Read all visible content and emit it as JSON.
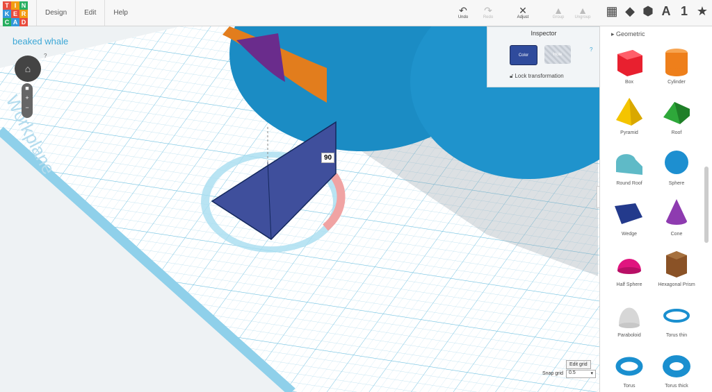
{
  "app": {
    "logo_letters": [
      "T",
      "I",
      "N",
      "K",
      "E",
      "R",
      "C",
      "A",
      "D"
    ],
    "logo_colors": [
      "#e84c3d",
      "#f39c12",
      "#27ae60",
      "#3498db",
      "#e84c3d",
      "#f39c12",
      "#27ae60",
      "#3498db",
      "#e84c3d"
    ]
  },
  "menu": [
    "Design",
    "Edit",
    "Help"
  ],
  "toolbar": {
    "undo": "Undo",
    "redo": "Redo",
    "adjust": "Adjust",
    "group": "Group",
    "ungroup": "Ungroup"
  },
  "project": {
    "title": "beaked whale",
    "help": "?"
  },
  "workplane_label": "Workplane",
  "rotation_value": "90",
  "inspector": {
    "title": "Inspector",
    "color_label": "Color",
    "hole_label": "Hole",
    "help": "?",
    "lock_label": "Lock transformation",
    "color_value": "#2f4b9c"
  },
  "sidebar": {
    "category": "Geometric",
    "shapes": [
      {
        "name": "Box",
        "color": "#e8202f"
      },
      {
        "name": "Cylinder",
        "color": "#ee7f1b"
      },
      {
        "name": "Pyramid",
        "color": "#f4c400"
      },
      {
        "name": "Roof",
        "color": "#2ea83a"
      },
      {
        "name": "Round Roof",
        "color": "#5fbac7"
      },
      {
        "name": "Sphere",
        "color": "#1d8fd0"
      },
      {
        "name": "Wedge",
        "color": "#233a8c"
      },
      {
        "name": "Cone",
        "color": "#8e3bb0"
      },
      {
        "name": "Half Sphere",
        "color": "#e0157f"
      },
      {
        "name": "Hexagonal Prism",
        "color": "#8a5226"
      },
      {
        "name": "Paraboloid",
        "color": "#d7d7d7"
      },
      {
        "name": "Torus thin",
        "color": "#1a8fcf"
      },
      {
        "name": "Torus",
        "color": "#1a8fcf"
      },
      {
        "name": "Torus thick",
        "color": "#1a8fcf"
      }
    ]
  },
  "grid": {
    "edit_label": "Edit grid",
    "snap_label": "Snap grid",
    "snap_value": "0.5"
  }
}
